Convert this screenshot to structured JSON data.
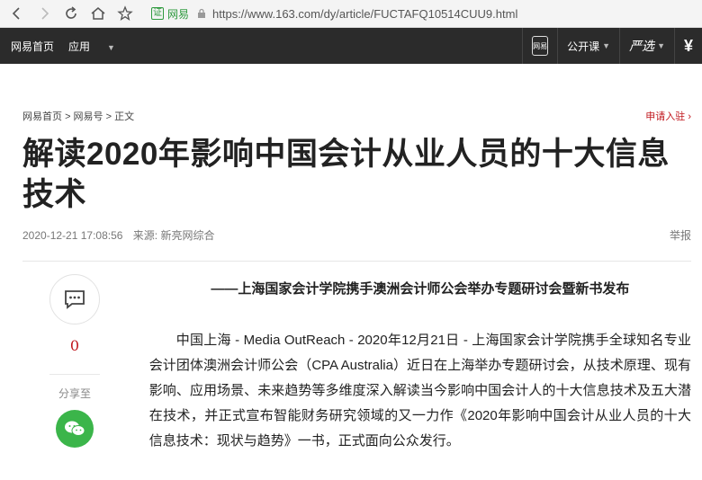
{
  "browser": {
    "site_name": "网易",
    "cert_label": "证",
    "url": "https://www.163.com/dy/article/FUCTAFQ10514CUU9.html"
  },
  "topnav": {
    "home": "网易首页",
    "apps": "应用",
    "phone_label": "网易",
    "open_course": "公开课",
    "yanxuan": "严选",
    "yen": "¥"
  },
  "breadcrumb": {
    "items": [
      "网易首页",
      "网易号",
      "正文"
    ],
    "apply": "申请入驻 ›"
  },
  "article": {
    "title": "解读2020年影响中国会计从业人员的十大信息技术",
    "date": "2020-12-21 17:08:56",
    "source": "来源: 新亮网综合",
    "report": "举报",
    "subtitle": "——上海国家会计学院携手澳洲会计师公会举办专题研讨会暨新书发布",
    "paragraph": "中国上海 - Media OutReach - 2020年12月21日 - 上海国家会计学院携手全球知名专业会计团体澳洲会计师公会（CPA Australia）近日在上海举办专题研讨会，从技术原理、现有影响、应用场景、未来趋势等多维度深入解读当今影响中国会计人的十大信息技术及五大潜在技术，并正式宣布智能财务研究领域的又一力作《2020年影响中国会计从业人员的十大信息技术：现状与趋势》一书，正式面向公众发行。"
  },
  "sidebar": {
    "comment_count": "0",
    "share_label": "分享至"
  }
}
